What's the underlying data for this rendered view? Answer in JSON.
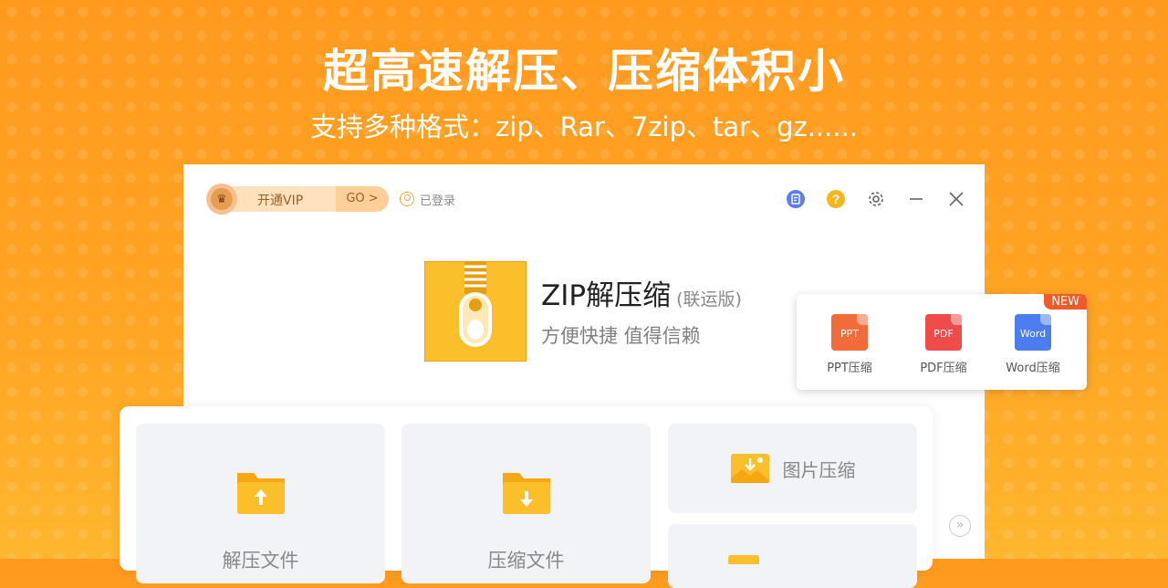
{
  "banner": {
    "headline": "超高速解压、压缩体积小",
    "subline": "支持多种格式：zip、Rar、7zip、tar、gz......"
  },
  "window": {
    "vip_label": "开通VIP",
    "vip_go": "GO >",
    "login_status": "已登录",
    "app_name": "ZIP解压缩",
    "app_edition": "(联运版)",
    "tagline": "方便快捷 值得信赖"
  },
  "popup": {
    "badge": "NEW",
    "items": [
      {
        "icon_text": "PPT",
        "label": "PPT压缩",
        "color": "#F26B3A"
      },
      {
        "icon_text": "PDF",
        "label": "PDF压缩",
        "color": "#EE4B4B"
      },
      {
        "icon_text": "Word",
        "label": "Word压缩",
        "color": "#4C7DF0"
      }
    ]
  },
  "actions": {
    "extract": "解压文件",
    "compress": "压缩文件",
    "image_compress": "图片压缩",
    "more": "»"
  },
  "colors": {
    "accent": "#FFA423",
    "folder": "#FBBF2C"
  }
}
